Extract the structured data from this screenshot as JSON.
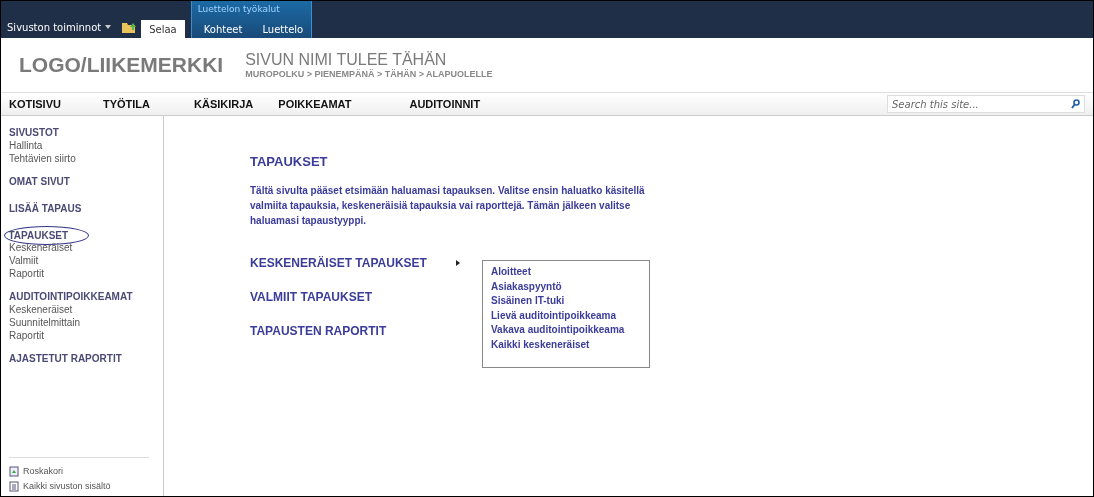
{
  "ribbon": {
    "site_actions": "Sivuston toiminnot",
    "tabs": [
      {
        "label": "Selaa",
        "selected": true
      },
      {
        "label": "Kohteet",
        "selected": false
      },
      {
        "label": "Luettelo",
        "selected": false
      }
    ],
    "tool_group": "Luettelon työkalut"
  },
  "header": {
    "logo": "LOGO/LIIKEMERKKI",
    "page_title": "SIVUN NIMI TULEE TÄHÄN",
    "breadcrumb": "MUROPOLKU > PIENEMPÄNÄ > TÄHÄN > ALAPUOLELLE"
  },
  "top_nav": [
    "KOTISIVU",
    "TYÖTILA",
    "KÄSIKIRJA",
    "POIKKEAMAT",
    "AUDITOINNIT"
  ],
  "search": {
    "placeholder": "Search this site..."
  },
  "sidebar": {
    "groups": [
      {
        "heading": "SIVUSTOT",
        "selected": false,
        "children": [
          "Hallinta",
          "Tehtävien siirto"
        ]
      },
      {
        "heading": "OMAT SIVUT",
        "selected": false
      },
      {
        "heading": "LISÄÄ TAPAUS",
        "selected": false
      },
      {
        "heading": "TAPAUKSET",
        "selected": true,
        "children": [
          "Keskeneräiset",
          "Valmiit",
          "Raportit"
        ]
      },
      {
        "heading": "AUDITOINTIPOIKKEAMAT",
        "selected": false,
        "children": [
          "Keskeneräiset",
          "Suunnitelmittain",
          "Raportit"
        ]
      },
      {
        "heading": "AJASTETUT RAPORTIT",
        "selected": false
      }
    ],
    "footer": [
      {
        "kind": "recycle",
        "label": "Roskakori"
      },
      {
        "kind": "content",
        "label": "Kaikki sivuston sisältö"
      }
    ]
  },
  "content": {
    "title": "TAPAUKSET",
    "intro": "Tältä sivulta pääset etsimään haluamasi tapauksen. Valitse ensin haluatko käsitellä valmiita tapauksia, keskeneräisiä tapauksia vai raporttejä. Tämän jälkeen valitse haluamasi tapaustyyppi.",
    "links": [
      {
        "label": "KESKENERÄISET TAPAUKSET",
        "expanded": true
      },
      {
        "label": "VALMIIT TAPAUKSET",
        "expanded": false
      },
      {
        "label": "TAPAUSTEN RAPORTIT",
        "expanded": false
      }
    ],
    "submenu": [
      "Aloitteet",
      "Asiakaspyyntö",
      "Sisäinen IT-tuki",
      "Lievä auditointipoikkeama",
      "Vakava auditointipoikkeama",
      "Kaikki keskeneräiset"
    ]
  }
}
